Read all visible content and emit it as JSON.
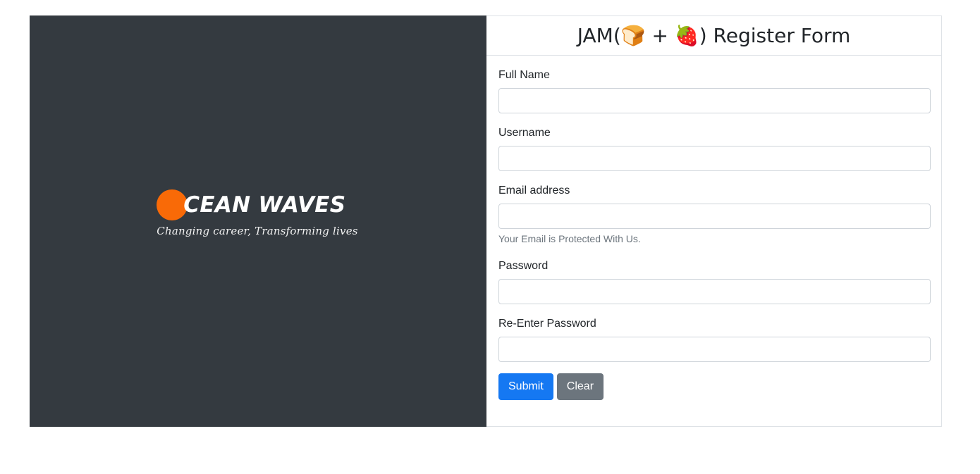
{
  "promo": {
    "brand_name": "CEAN WAVES",
    "brand_initial_icon": "orange-circle-letter-o",
    "tagline": "Changing career, Transforming lives",
    "background_color": "#343a40",
    "accent_color": "#f96a07"
  },
  "card": {
    "title": "JAM(🍞 + 🍓) Register Form",
    "fields": [
      {
        "label": "Full Name",
        "name": "full-name",
        "type": "text",
        "value": "",
        "placeholder": "",
        "help": ""
      },
      {
        "label": "Username",
        "name": "username",
        "type": "text",
        "value": "",
        "placeholder": "",
        "help": ""
      },
      {
        "label": "Email address",
        "name": "email",
        "type": "email",
        "value": "",
        "placeholder": "",
        "help": "Your Email is Protected With Us."
      },
      {
        "label": "Password",
        "name": "password",
        "type": "password",
        "value": "",
        "placeholder": "",
        "help": ""
      },
      {
        "label": "Re-Enter Password",
        "name": "confirm-password",
        "type": "password",
        "value": "",
        "placeholder": "",
        "help": ""
      }
    ],
    "buttons": {
      "submit_label": "Submit",
      "clear_label": "Clear",
      "submit_color": "#1578f2",
      "clear_color": "#6c757d"
    }
  }
}
